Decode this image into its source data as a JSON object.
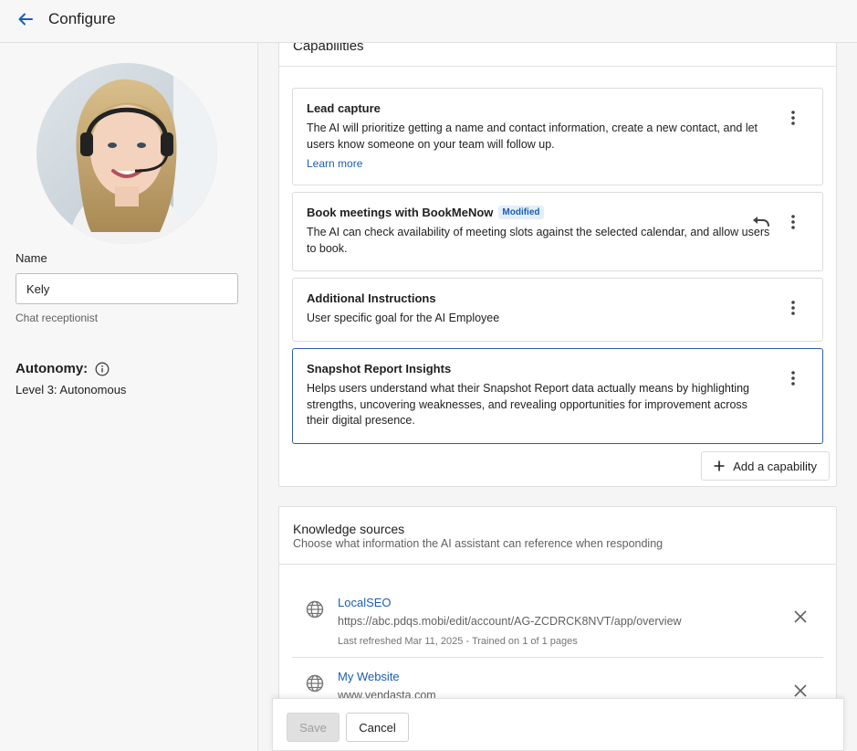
{
  "header": {
    "title": "Configure",
    "back_icon": "arrow-left-icon"
  },
  "profile": {
    "name_label": "Name",
    "name_value": "Kely",
    "role": "Chat receptionist",
    "autonomy_label": "Autonomy:",
    "autonomy_level": "Level 3: Autonomous"
  },
  "capabilities": {
    "heading": "Capabilities",
    "items": [
      {
        "name": "Lead capture",
        "description": "The AI will prioritize getting a name and contact information, create a new contact, and let users know someone on your team will follow up.",
        "link": "Learn more"
      },
      {
        "name": "Book meetings with BookMeNow",
        "badge": "Modified",
        "description": "The AI can check availability of meeting slots against the selected calendar, and allow users to book."
      },
      {
        "name": "Additional Instructions",
        "description": "User specific goal for the AI Employee"
      },
      {
        "name": "Snapshot Report Insights",
        "description": "Helps users understand what their Snapshot Report data actually means by highlighting strengths, uncovering weaknesses, and revealing opportunities for improvement across their digital presence."
      }
    ],
    "add_button": "Add a capability"
  },
  "knowledge": {
    "title": "Knowledge sources",
    "subtitle": "Choose what information the AI assistant can reference when responding",
    "sources": [
      {
        "name": "LocalSEO",
        "url": "https://abc.pdqs.mobi/edit/account/AG-ZCDRCK8NVT/app/overview",
        "meta": "Last refreshed Mar 11, 2025 - Trained on 1 of 1 pages"
      },
      {
        "name": "My Website",
        "url": "www.vendasta.com"
      }
    ]
  },
  "footer": {
    "save": "Save",
    "cancel": "Cancel"
  },
  "colors": {
    "link": "#1a5fb4",
    "selected_border": "#2f5da8",
    "badge_bg": "#e3eefb"
  }
}
